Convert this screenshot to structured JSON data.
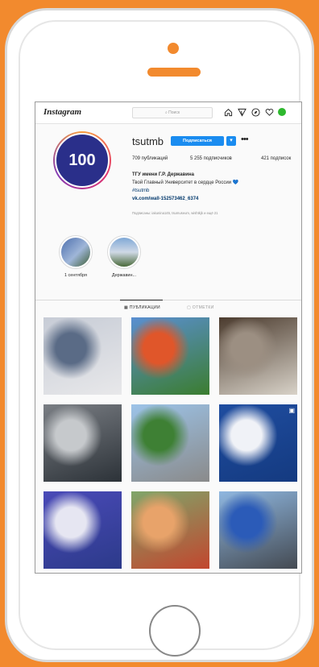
{
  "topbar": {
    "logo": "Instagram",
    "search_placeholder": "Поиск",
    "icons": [
      "home-icon",
      "send-icon",
      "compass-icon",
      "heart-icon",
      "profile-avatar"
    ]
  },
  "profile": {
    "username": "tsutmb",
    "follow_label": "Подписаться",
    "posts": "709 публикаций",
    "followers": "5 255 подписчиков",
    "following": "421 подписок",
    "name": "ТГУ имени Г.Р. Державина",
    "bio_line": "Твой Главный Университет в сердце России 💙",
    "hashtag": "#tsutmb",
    "link": "vk.com/wall-152573462_6374",
    "followed_by": "Подписаны: iakunina145, tsumuseum, wishtkjk и ещё 21",
    "avatar_text": "100"
  },
  "highlights": [
    {
      "label": "1 сентября"
    },
    {
      "label": "Державин..."
    }
  ],
  "tabs": {
    "posts": "ПУБЛИКАЦИИ",
    "tagged": "ОТМЕТКИ"
  },
  "posts": [
    {
      "name": "post-1",
      "colors": [
        "#c7ccd6",
        "#5a6b86",
        "#e8e8ea"
      ]
    },
    {
      "name": "post-2",
      "colors": [
        "#5a8fd1",
        "#e0562a",
        "#3b7d2f"
      ]
    },
    {
      "name": "post-3",
      "colors": [
        "#4b3b2e",
        "#9c8f82",
        "#d8d2c8"
      ]
    },
    {
      "name": "post-4",
      "colors": [
        "#7a7e84",
        "#c6c9cc",
        "#2c3238"
      ]
    },
    {
      "name": "post-5",
      "colors": [
        "#9cc3e8",
        "#3e8034",
        "#8a8a8a"
      ]
    },
    {
      "name": "post-6",
      "colors": [
        "#1f4da0",
        "#f0f2f7",
        "#143a80"
      ]
    },
    {
      "name": "post-7",
      "colors": [
        "#4a4ab8",
        "#e6e6f2",
        "#2c3a8a"
      ]
    },
    {
      "name": "post-8",
      "colors": [
        "#7fa66a",
        "#e8a36a",
        "#c2462e"
      ]
    },
    {
      "name": "post-9",
      "colors": [
        "#8fb7e0",
        "#2b5bb8",
        "#444a52"
      ]
    }
  ],
  "colors": {
    "background": "#f28a2e",
    "follow_button": "#1a8cf0"
  }
}
